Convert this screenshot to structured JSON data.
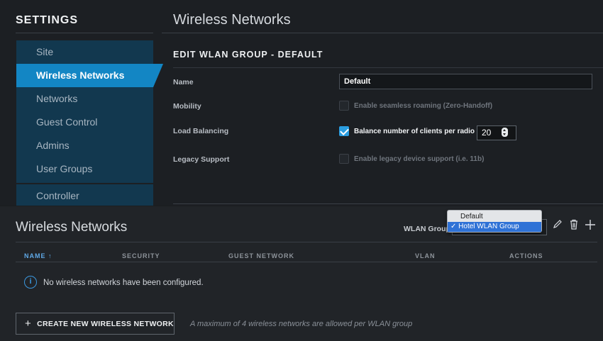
{
  "settings": {
    "title": "SETTINGS",
    "page_title": "Wireless Networks",
    "sidebar": {
      "items": [
        {
          "label": "Site"
        },
        {
          "label": "Wireless Networks",
          "active": true
        },
        {
          "label": "Networks"
        },
        {
          "label": "Guest Control"
        },
        {
          "label": "Admins"
        },
        {
          "label": "User Groups"
        },
        {
          "label": "Controller"
        }
      ]
    },
    "edit": {
      "title": "EDIT WLAN GROUP - DEFAULT",
      "name_label": "Name",
      "name_value": "Default",
      "mobility_label": "Mobility",
      "mobility_option": "Enable seamless roaming (Zero-Handoff)",
      "mobility_checked": false,
      "load_balancing_label": "Load Balancing",
      "load_balancing_option": "Balance number of clients per radio",
      "load_balancing_checked": true,
      "load_balancing_value": "20",
      "legacy_label": "Legacy Support",
      "legacy_option": "Enable legacy device support (i.e. 11b)",
      "legacy_checked": false
    }
  },
  "wireless": {
    "title": "Wireless Networks",
    "wlan_group_label": "WLAN Group",
    "dropdown_options": [
      "Default",
      "✓ Hotel WLAN Group"
    ],
    "selected_option": "Hotel WLAN Group",
    "columns": [
      "NAME ↑",
      "SECURITY",
      "GUEST NETWORK",
      "VLAN",
      "ACTIONS"
    ],
    "empty_message": "No wireless networks have been configured.",
    "create_button": "CREATE NEW WIRELESS NETWORK",
    "create_icon": "+",
    "max_note": "A maximum of 4 wireless networks are allowed per WLAN group",
    "info_glyph": "i",
    "icons": [
      "pencil-icon",
      "trash-icon",
      "plus-icon"
    ]
  },
  "colors": {
    "accent": "#1386c4",
    "sidebar_bg": "#12384f",
    "checkbox_on": "#2a9de0"
  }
}
